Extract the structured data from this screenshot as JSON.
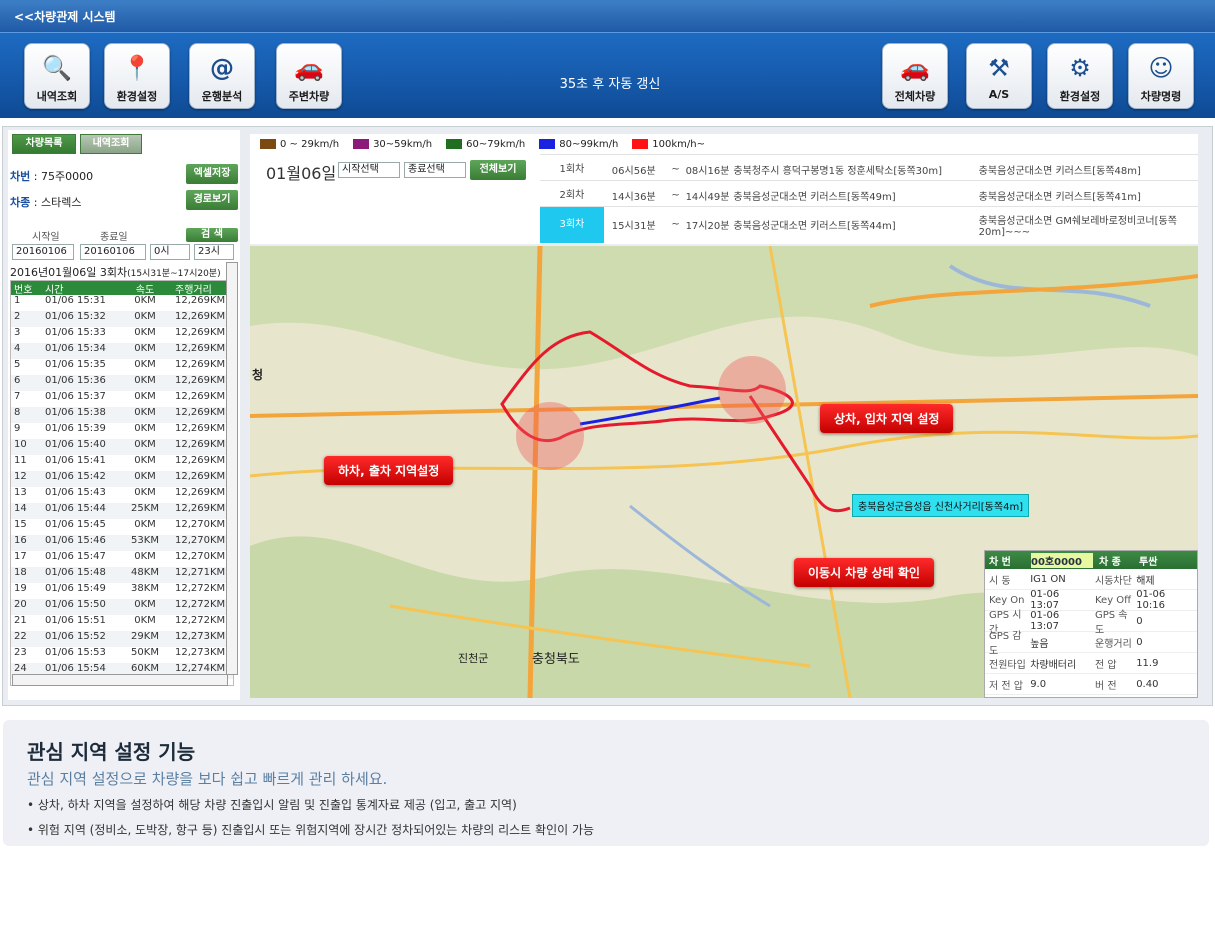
{
  "app": {
    "title": "<<차량관제 시스템"
  },
  "toolbar": {
    "left_buttons": [
      {
        "label": "내역조회",
        "icon": "search-icon"
      },
      {
        "label": "환경설정",
        "icon": "map-pin-icon"
      },
      {
        "label": "운행분석",
        "icon": "address-book-icon"
      },
      {
        "label": "주변차량",
        "icon": "car-icon"
      }
    ],
    "refresh_text": "35초 후 자동 갱신",
    "right_buttons": [
      {
        "label": "전체차량",
        "icon": "car-icon"
      },
      {
        "label": "A/S",
        "icon": "tools-icon"
      },
      {
        "label": "환경설정",
        "icon": "gears-icon"
      },
      {
        "label": "차량명령",
        "icon": "robot-icon"
      }
    ]
  },
  "left": {
    "tab_list": "차량목록",
    "tab_history": "내역조회",
    "car_no_label": "차번",
    "car_no": "75주0000",
    "car_type_label": "차종",
    "car_type": "스타렉스",
    "excel_button": "엑셀저장",
    "route_button": "경로보기",
    "start_label": "시작일",
    "end_label": "종료일",
    "search_button": "검 색",
    "start_date": "20160106",
    "end_date": "20160106",
    "start_hour": "0시",
    "end_hour": "23시",
    "summary": "2016년01월06일 3회차",
    "summary_range": "(15시31분~17시20분)",
    "columns": [
      "번호",
      "시간",
      "속도",
      "주행거리"
    ],
    "rows": [
      [
        "1",
        "01/06 15:31",
        "0KM",
        "12,269KM"
      ],
      [
        "2",
        "01/06 15:32",
        "0KM",
        "12,269KM"
      ],
      [
        "3",
        "01/06 15:33",
        "0KM",
        "12,269KM"
      ],
      [
        "4",
        "01/06 15:34",
        "0KM",
        "12,269KM"
      ],
      [
        "5",
        "01/06 15:35",
        "0KM",
        "12,269KM"
      ],
      [
        "6",
        "01/06 15:36",
        "0KM",
        "12,269KM"
      ],
      [
        "7",
        "01/06 15:37",
        "0KM",
        "12,269KM"
      ],
      [
        "8",
        "01/06 15:38",
        "0KM",
        "12,269KM"
      ],
      [
        "9",
        "01/06 15:39",
        "0KM",
        "12,269KM"
      ],
      [
        "10",
        "01/06 15:40",
        "0KM",
        "12,269KM"
      ],
      [
        "11",
        "01/06 15:41",
        "0KM",
        "12,269KM"
      ],
      [
        "12",
        "01/06 15:42",
        "0KM",
        "12,269KM"
      ],
      [
        "13",
        "01/06 15:43",
        "0KM",
        "12,269KM"
      ],
      [
        "14",
        "01/06 15:44",
        "25KM",
        "12,269KM"
      ],
      [
        "15",
        "01/06 15:45",
        "0KM",
        "12,270KM"
      ],
      [
        "16",
        "01/06 15:46",
        "53KM",
        "12,270KM"
      ],
      [
        "17",
        "01/06 15:47",
        "0KM",
        "12,270KM"
      ],
      [
        "18",
        "01/06 15:48",
        "48KM",
        "12,271KM"
      ],
      [
        "19",
        "01/06 15:49",
        "38KM",
        "12,272KM"
      ],
      [
        "20",
        "01/06 15:50",
        "0KM",
        "12,272KM"
      ],
      [
        "21",
        "01/06 15:51",
        "0KM",
        "12,272KM"
      ],
      [
        "22",
        "01/06 15:52",
        "29KM",
        "12,273KM"
      ],
      [
        "23",
        "01/06 15:53",
        "50KM",
        "12,273KM"
      ],
      [
        "24",
        "01/06 15:54",
        "60KM",
        "12,274KM"
      ]
    ]
  },
  "legend": [
    {
      "label": "0 ~ 29km/h",
      "color": "#7a4a12"
    },
    {
      "label": "30~59km/h",
      "color": "#8b1a7a"
    },
    {
      "label": "60~79km/h",
      "color": "#1f6e22"
    },
    {
      "label": "80~99km/h",
      "color": "#1a22e0"
    },
    {
      "label": "100km/h~",
      "color": "#ff1212"
    }
  ],
  "trips": {
    "date": "01월06일",
    "start_select": "시작선택",
    "end_select": "종료선택",
    "view_all": "전체보기",
    "rows": [
      {
        "n": "1회차",
        "t1": "06시56분",
        "tilde": "~",
        "t2": "08시16분",
        "from": "충북청주시 흥덕구봉명1동 정훈세탁소[동쪽30m]",
        "to": "충북음성군대소면 키러스트[동쪽48m]"
      },
      {
        "n": "2회차",
        "t1": "14시36분",
        "tilde": "~",
        "t2": "14시49분",
        "from": "충북음성군대소면 키러스트[동쪽49m]",
        "to": "충북음성군대소면 키러스트[동쪽41m]"
      },
      {
        "n": "3회차",
        "t1": "15시31분",
        "tilde": "~",
        "t2": "17시20분",
        "from": "충북음성군대소면 키러스트[동쪽44m]",
        "to": "충북음성군대소면 GM쉐보레바로정비코너[동쪽20m]~~~"
      }
    ]
  },
  "map": {
    "callout_load": "상차, 입차 지역 설정",
    "callout_unload": "하차, 출차 지역설정",
    "callout_status": "이동시 차량 상태 확인",
    "place_label": "충북음성군음성읍 신천사거리[동쪽4m]",
    "towns": [
      "진천군",
      "충청북도",
      "청"
    ]
  },
  "status": {
    "car_label": "차 번",
    "car_no": "00호0000",
    "type_label": "차 종",
    "type": "투싼",
    "rows": [
      [
        "시 동",
        "IG1 ON",
        "시동차단",
        "해제"
      ],
      [
        "Key On",
        "01-06 13:07",
        "Key Off",
        "01-06 10:16"
      ],
      [
        "GPS 시간",
        "01-06 13:07",
        "GPS 속도",
        "0"
      ],
      [
        "GPS 감도",
        "높음",
        "운행거리",
        "0"
      ],
      [
        "전원타입",
        "차량배터리",
        "전 압",
        "11.9"
      ],
      [
        "저 전 압",
        "9.0",
        "버 전",
        "0.40"
      ]
    ]
  },
  "feature": {
    "title": "관심 지역 설정 기능",
    "subtitle": "관심 지역 설정으로 차량을 보다 쉽고 빠르게 관리 하세요.",
    "bullet1": "• 상차, 하차 지역을 설정하여 해당 차량 진출입시 알림 및 진출입 통계자료 제공 (입고, 출고 지역)",
    "bullet2": "• 위험 지역 (정비소, 도박장, 항구 등) 진출입시 또는 위험지역에 장시간 정차되어있는 차량의 리스트 확인이 가능"
  }
}
